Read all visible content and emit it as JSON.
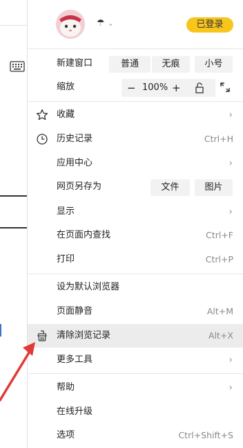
{
  "header": {
    "login_label": "已登录",
    "mode_icon": "umbrella-icon"
  },
  "new_window": {
    "label": "新建窗口",
    "normal": "普通",
    "incognito": "无痕",
    "small": "小号"
  },
  "zoom": {
    "label": "缩放",
    "minus": "−",
    "value": "100%",
    "plus": "+"
  },
  "menu": {
    "favorites": {
      "label": "收藏",
      "icon": "star-icon"
    },
    "history": {
      "label": "历史记录",
      "shortcut": "Ctrl+H",
      "icon": "clock-icon"
    },
    "apps": {
      "label": "应用中心"
    },
    "save_as": {
      "label": "网页另存为",
      "file": "文件",
      "image": "图片"
    },
    "display": {
      "label": "显示"
    },
    "find": {
      "label": "在页面内查找",
      "shortcut": "Ctrl+F"
    },
    "print": {
      "label": "打印",
      "shortcut": "Ctrl+P"
    },
    "default_browser": {
      "label": "设为默认浏览器"
    },
    "mute": {
      "label": "页面静音",
      "shortcut": "Alt+M"
    },
    "clear_history": {
      "label": "清除浏览记录",
      "shortcut": "Alt+X",
      "icon": "broom-icon"
    },
    "more_tools": {
      "label": "更多工具"
    },
    "help": {
      "label": "帮助"
    },
    "upgrade": {
      "label": "在线升级"
    },
    "options": {
      "label": "选项",
      "shortcut": "Ctrl+Shift+S"
    }
  },
  "colors": {
    "login_bg": "#f8c51c",
    "highlight_bg": "#ececec",
    "arrow": "#e23a36"
  }
}
